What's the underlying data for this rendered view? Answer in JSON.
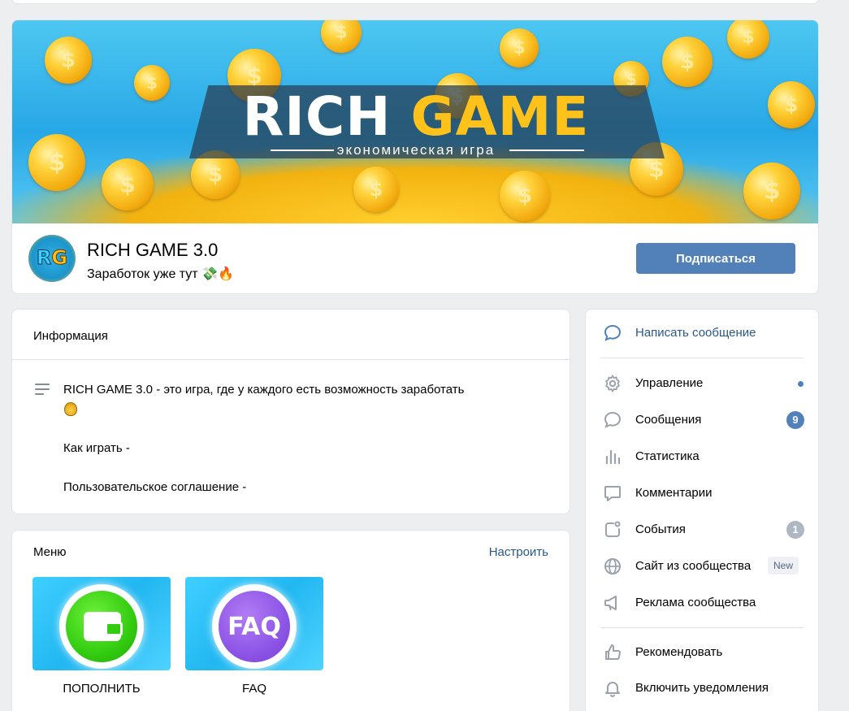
{
  "group": {
    "cover": {
      "title_white": "RICH ",
      "title_yellow": "GAME",
      "subtitle": "экономическая игра"
    },
    "avatar_text_a": "R",
    "avatar_text_b": "G",
    "name": "RICH GAME 3.0",
    "status": "Заработок уже тут 💸🔥",
    "subscribe_label": "Подписаться"
  },
  "info": {
    "title": "Информация",
    "description_line1": "RICH GAME 3.0 - это игра, где у каждого есть возможность заработать",
    "description_line2": "Как играть -",
    "description_line3": "Пользовательское соглашение -"
  },
  "menu": {
    "title": "Меню",
    "configure_label": "Настроить",
    "items": [
      {
        "label": "ПОПОЛНИТЬ",
        "icon": "wallet-icon"
      },
      {
        "label": "FAQ",
        "icon": "faq-icon",
        "tile_text": "FAQ"
      }
    ]
  },
  "sidebar": {
    "write_message": "Написать сообщение",
    "items": [
      {
        "label": "Управление",
        "icon": "gear-icon"
      },
      {
        "label": "Сообщения",
        "icon": "chat-icon",
        "badge": "9"
      },
      {
        "label": "Статистика",
        "icon": "stats-icon"
      },
      {
        "label": "Комментарии",
        "icon": "comment-icon"
      },
      {
        "label": "События",
        "icon": "events-icon",
        "badge": "1"
      },
      {
        "label": "Сайт из сообщества",
        "icon": "globe-icon",
        "tag": "New"
      },
      {
        "label": "Реклама сообщества",
        "icon": "megaphone-icon"
      }
    ],
    "bottom_items": [
      {
        "label": "Рекомендовать",
        "icon": "thumbs-up-icon"
      },
      {
        "label": "Включить уведомления",
        "icon": "bell-icon"
      }
    ]
  },
  "colors": {
    "background": "#edeef0",
    "accent": "#5181b8",
    "link": "#2a5885",
    "icon": "#99a2ad"
  }
}
